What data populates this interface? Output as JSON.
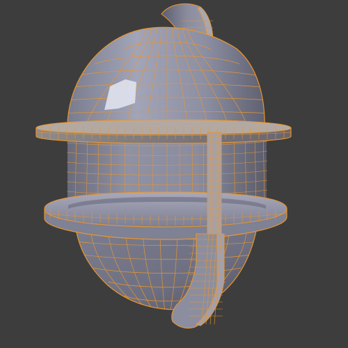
{
  "viewport": {
    "background": "#3d3d3d",
    "object": "mesh-object",
    "mode": "edit-mode-wireframe-overlay"
  },
  "colors": {
    "background": "#3d3d3d",
    "face_light": "#9a9cb2",
    "face_mid": "#858799",
    "face_dark": "#5d5f6e",
    "edge_selected": "#e8962e",
    "highlight": "#e9ecf6"
  }
}
